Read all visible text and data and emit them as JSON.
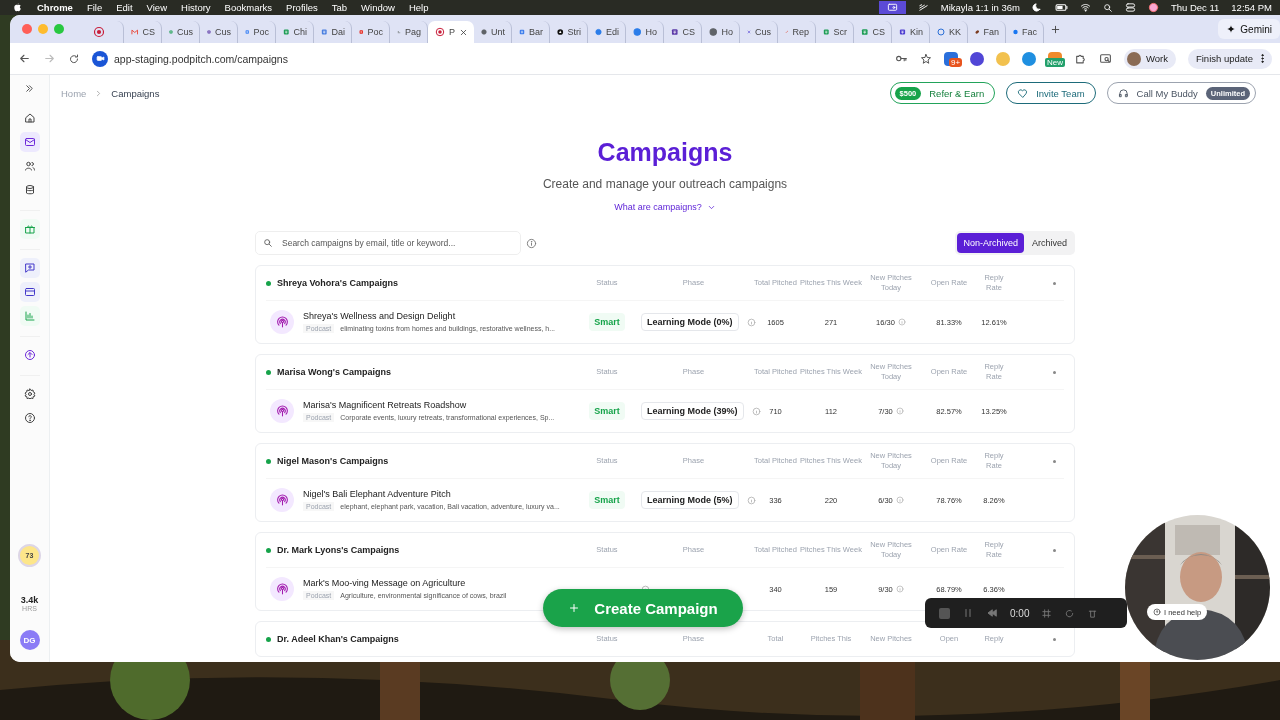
{
  "menu_bar": {
    "app": "Chrome",
    "menus": [
      "File",
      "Edit",
      "View",
      "History",
      "Bookmarks",
      "Profiles",
      "Tab",
      "Window",
      "Help"
    ],
    "status_text": "Mikayla 1:1 in 36m",
    "date": "Thu Dec 11",
    "time": "12:54 PM"
  },
  "browser": {
    "tabs": [
      {
        "kind": "record",
        "selected": false
      },
      {
        "kind": "mail",
        "label": "CS",
        "selected": false
      },
      {
        "kind": "sheet",
        "label": "Cus",
        "selected": false
      },
      {
        "kind": "grid",
        "label": "Cus",
        "selected": false
      },
      {
        "kind": "calendar",
        "label": "Poc",
        "selected": false
      },
      {
        "kind": "sheet",
        "label": "Chi",
        "selected": false
      },
      {
        "kind": "doc",
        "label": "Dai",
        "selected": false
      },
      {
        "kind": "video",
        "label": "Poc",
        "selected": false
      },
      {
        "kind": "puzzle",
        "label": "Pag",
        "selected": false
      },
      {
        "kind": "record",
        "label": "P",
        "selected": true
      },
      {
        "kind": "globe",
        "label": "Unt",
        "selected": false
      },
      {
        "kind": "swirl",
        "label": "Bar",
        "selected": false
      },
      {
        "kind": "triangle",
        "label": "Stri",
        "selected": false
      },
      {
        "kind": "circle",
        "label": "Edi",
        "selected": false
      },
      {
        "kind": "circle",
        "label": "Ho",
        "selected": false
      },
      {
        "kind": "grid",
        "label": "CS",
        "selected": false
      },
      {
        "kind": "globe",
        "label": "Ho",
        "selected": false
      },
      {
        "kind": "cross",
        "label": "Cus",
        "selected": false
      },
      {
        "kind": "network",
        "label": "Rep",
        "selected": false
      },
      {
        "kind": "sheet",
        "label": "Scr",
        "selected": false
      },
      {
        "kind": "sheet",
        "label": "CS",
        "selected": false
      },
      {
        "kind": "square",
        "label": "Kin",
        "selected": false
      },
      {
        "kind": "ring",
        "label": "KK",
        "selected": false
      },
      {
        "kind": "ball",
        "label": "Fan",
        "selected": false
      },
      {
        "kind": "facebook",
        "label": "Fac",
        "selected": false
      }
    ],
    "gemini": "Gemini",
    "url": "app-staging.podpitch.com/campaigns",
    "extension_badge": "9+",
    "extension_new": "New",
    "profile": "Work",
    "update_button": "Finish update"
  },
  "sidebar": {
    "groups": [
      [
        {
          "kind": "home",
          "selected": false
        },
        {
          "kind": "mail",
          "selected": true
        },
        {
          "kind": "people",
          "selected": false
        },
        {
          "kind": "database",
          "selected": false
        }
      ],
      [
        {
          "kind": "gift",
          "selected": false
        }
      ],
      [
        {
          "kind": "chat",
          "selected": false
        },
        {
          "kind": "card",
          "selected": false
        },
        {
          "kind": "chart",
          "selected": false
        }
      ],
      [
        {
          "kind": "upload",
          "selected": false
        }
      ],
      [
        {
          "kind": "settings",
          "selected": false
        },
        {
          "kind": "help",
          "selected": false
        }
      ]
    ],
    "score": "73",
    "hours": "3.4k",
    "hours_unit": "HRS",
    "avatar": "DG"
  },
  "breadcrumb": [
    "Home",
    "Campaigns"
  ],
  "refer": {
    "badge": "$500",
    "label": "Refer & Earn"
  },
  "invite": {
    "label": "Invite Team"
  },
  "call": {
    "label": "Call My Buddy",
    "badge": "Unlimited"
  },
  "title": "Campaigns",
  "subtitle": "Create and manage your outreach campaigns",
  "help_link": "What are campaigns?",
  "search": {
    "placeholder": "Search campaigns by email, title or keyword..."
  },
  "filter_tabs": [
    {
      "label": "Non-Archived",
      "selected": true
    },
    {
      "label": "Archived",
      "selected": false
    }
  ],
  "groups": [
    {
      "name": "Shreya Vohora's Campaigns",
      "columns": [
        "Status",
        "Phase",
        "Total Pitched",
        "Pitches This Week",
        "New Pitches Today",
        "Open Rate",
        "Reply Rate"
      ],
      "campaigns": [
        {
          "name": "Shreya's Wellness and Design Delight",
          "type": "Podcast",
          "keywords": "eliminating toxins from homes and buildings, restorative wellness, h...",
          "status": "Smart",
          "phase": "Learning Mode (0%)",
          "total": "1605",
          "week": "271",
          "today": "16/30",
          "open": "81.33%",
          "reply": "12.61%"
        }
      ]
    },
    {
      "name": "Marisa Wong's Campaigns",
      "columns": [
        "Status",
        "Phase",
        "Total Pitched",
        "Pitches This Week",
        "New Pitches Today",
        "Open Rate",
        "Reply Rate"
      ],
      "campaigns": [
        {
          "name": "Marisa's Magnificent Retreats Roadshow",
          "type": "Podcast",
          "keywords": "Corporate events, luxury retreats, transformational experiences, Sp...",
          "status": "Smart",
          "phase": "Learning Mode (39%)",
          "total": "710",
          "week": "112",
          "today": "7/30",
          "open": "82.57%",
          "reply": "13.25%"
        }
      ]
    },
    {
      "name": "Nigel Mason's Campaigns",
      "columns": [
        "Status",
        "Phase",
        "Total Pitched",
        "Pitches This Week",
        "New Pitches Today",
        "Open Rate",
        "Reply Rate"
      ],
      "campaigns": [
        {
          "name": "Nigel's Bali Elephant Adventure Pitch",
          "type": "Podcast",
          "keywords": "elephant, elephant park, vacation, Bali vacation, adventure, luxury va...",
          "status": "Smart",
          "phase": "Learning Mode (5%)",
          "total": "336",
          "week": "220",
          "today": "6/30",
          "open": "78.76%",
          "reply": "8.26%"
        }
      ]
    },
    {
      "name": "Dr. Mark Lyons's Campaigns",
      "columns": [
        "Status",
        "Phase",
        "Total Pitched",
        "Pitches This Week",
        "New Pitches Today",
        "Open Rate",
        "Reply Rate"
      ],
      "campaigns": [
        {
          "name": "Mark's Moo-ving Message on Agriculture",
          "type": "Podcast",
          "keywords": "Agriculture, environmental significance of cows, brazil",
          "total": "340",
          "week": "159",
          "today": "9/30",
          "open": "68.79%",
          "reply": "6.36%"
        }
      ]
    },
    {
      "name": "Dr. Adeel Khan's Campaigns",
      "columns": [
        "Status",
        "Phase",
        "Total",
        "Pitches This",
        "New Pitches",
        "Open",
        "Reply"
      ]
    }
  ],
  "create_button": "Create Campaign",
  "recorder": {
    "time": "0:00",
    "help": "I need help"
  }
}
